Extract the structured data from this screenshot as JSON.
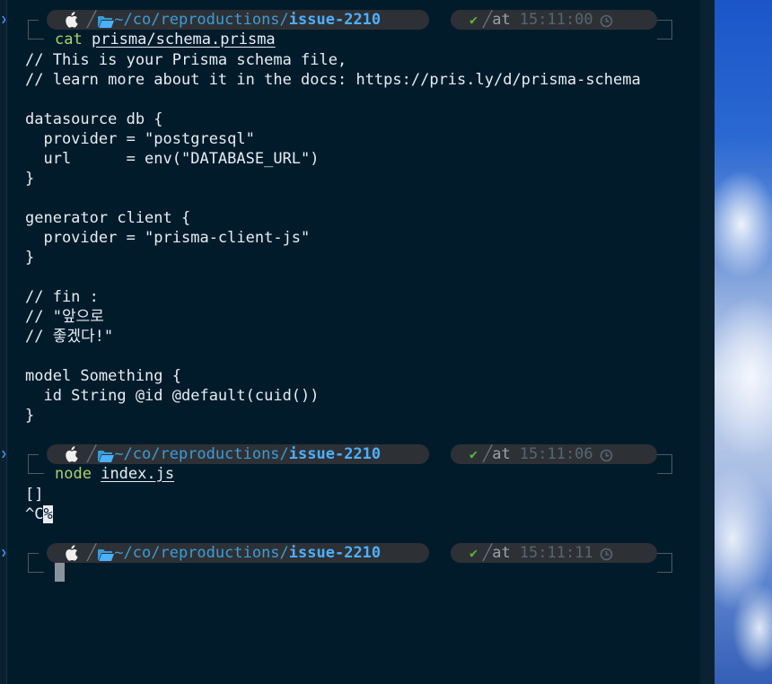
{
  "colors": {
    "background": "#021b2b",
    "segment": "#2d3136",
    "path_dim": "#3a9cd6",
    "path_bold": "#4bb0ff",
    "command": "#a9d26a",
    "text": "#e6edf3",
    "check": "#5bb53c",
    "time": "#56666f"
  },
  "prompt": {
    "os_icon": "apple-icon",
    "folder_icon": "folder-open-icon",
    "path_home": "~",
    "path_sep": "/",
    "path_1": "co",
    "path_2": "reproductions",
    "path_current": "issue-2210",
    "status_icon": "check-icon",
    "at_label": "at",
    "clock_icon": "clock-icon"
  },
  "blocks": [
    {
      "time": "15:11:00",
      "command": "cat",
      "argument": "prisma/schema.prisma",
      "output": [
        "// This is your Prisma schema file,",
        "// learn more about it in the docs: https://pris.ly/d/prisma-schema",
        "",
        "datasource db {",
        "  provider = \"postgresql\"",
        "  url      = env(\"DATABASE_URL\")",
        "}",
        "",
        "generator client {",
        "  provider = \"prisma-client-js\"",
        "}",
        "",
        "// fin :",
        "// \"앞으로",
        "// 좋겠다!\"",
        "",
        "model Something {",
        "  id String @id @default(cuid())",
        "}"
      ]
    },
    {
      "time": "15:11:06",
      "command": "node",
      "argument": "index.js",
      "output": [
        "[]"
      ],
      "interrupt": "^C",
      "eol_mark": "%"
    },
    {
      "time": "15:11:11",
      "command": "",
      "argument": ""
    }
  ]
}
